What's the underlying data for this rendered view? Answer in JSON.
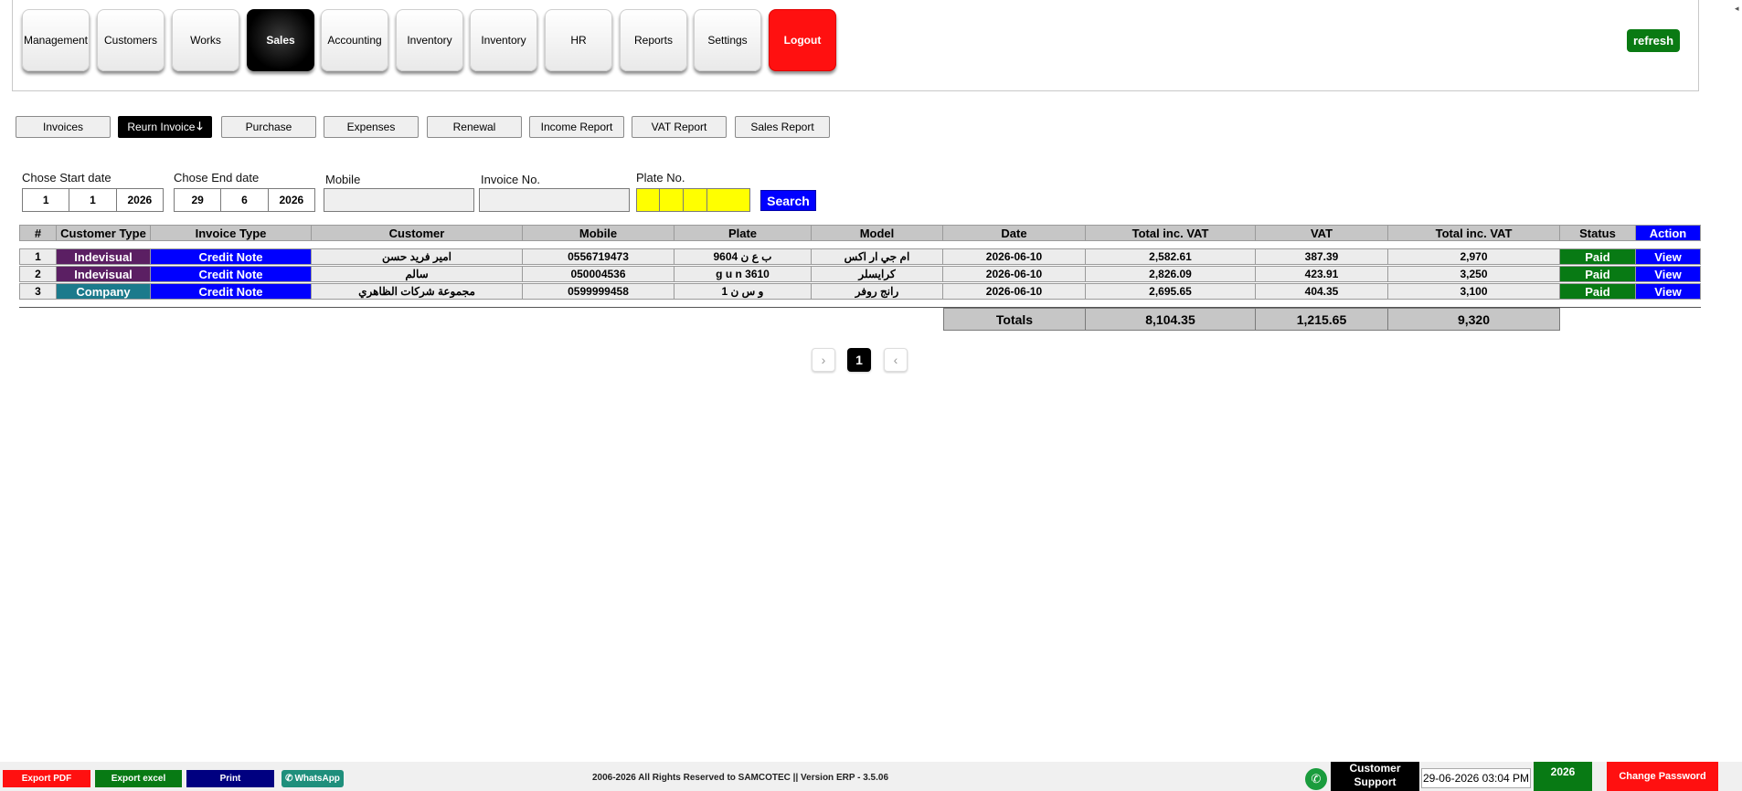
{
  "nav": [
    {
      "label": "Management"
    },
    {
      "label": "Customers"
    },
    {
      "label": "Works"
    },
    {
      "label": "Sales"
    },
    {
      "label": "Accounting"
    },
    {
      "label": "Inventory"
    },
    {
      "label": "Inventory"
    },
    {
      "label": "HR"
    },
    {
      "label": "Reports"
    },
    {
      "label": "Settings"
    },
    {
      "label": "Logout"
    }
  ],
  "refresh_label": "refresh",
  "submenu": [
    {
      "label": "Invoices"
    },
    {
      "label": "Reurn Invoice"
    },
    {
      "label": "Purchase"
    },
    {
      "label": "Expenses"
    },
    {
      "label": "Renewal"
    },
    {
      "label": "Income Report"
    },
    {
      "label": "VAT Report"
    },
    {
      "label": "Sales Report"
    }
  ],
  "submenu_arrow": "🡓",
  "filters": {
    "start_label": "Chose Start date",
    "start": {
      "d": "1",
      "m": "1",
      "y": "2026"
    },
    "end_label": "Chose End date",
    "end": {
      "d": "29",
      "m": "6",
      "y": "2026"
    },
    "mobile_label": "Mobile",
    "invoice_label": "Invoice No.",
    "plate_label": "Plate No.",
    "search_label": "Search"
  },
  "table": {
    "headers": [
      "#",
      "Customer Type",
      "Invoice Type",
      "Customer",
      "Mobile",
      "Plate",
      "Model",
      "Date",
      "Total inc. VAT",
      "VAT",
      "Total inc. VAT",
      "Status",
      "Action"
    ],
    "rows": [
      [
        "1",
        "Indevisual",
        "Credit Note",
        "امير فريد حسن",
        "0556719473",
        "ب ع ن 9604",
        "ام جي ار اكس",
        "2026-06-10",
        "2,582.61",
        "387.39",
        "2,970",
        "Paid",
        "View"
      ],
      [
        "2",
        "Indevisual",
        "Credit Note",
        "سالم",
        "050004536",
        "g u n 3610",
        "كرايسلر",
        "2026-06-10",
        "2,826.09",
        "423.91",
        "3,250",
        "Paid",
        "View"
      ],
      [
        "3",
        "Company",
        "Credit Note",
        "مجموعة شركات الظاهري",
        "0599999458",
        "و س ن 1",
        "رانج روفر",
        "2026-06-10",
        "2,695.65",
        "404.35",
        "3,100",
        "Paid",
        "View"
      ]
    ],
    "totals": {
      "label": "Totals",
      "total_ex": "8,104.35",
      "vat": "1,215.65",
      "total": "9,320"
    }
  },
  "pagination": {
    "next": "›",
    "current": "1",
    "prev": "‹"
  },
  "footer": {
    "export_pdf": "Export PDF",
    "export_excel": "Export excel",
    "print": "Print",
    "whatsapp": "WhatsApp",
    "copyright": "2006-2026 All Rights Reserved to SAMCOTEC || Version ERP - 3.5.06",
    "support": "Customer Support",
    "datetime": "29-06-2026 03:04 PM",
    "year": "2026",
    "change_password": "Change Password"
  },
  "colors": {
    "active": "#000000",
    "logout": "#ff1010",
    "refresh": "#0a7a13",
    "primary": "#0000ff",
    "paid": "#087a14",
    "individual": "#5b1f63",
    "company": "#1b7a8c",
    "plate": "#ffff00"
  }
}
